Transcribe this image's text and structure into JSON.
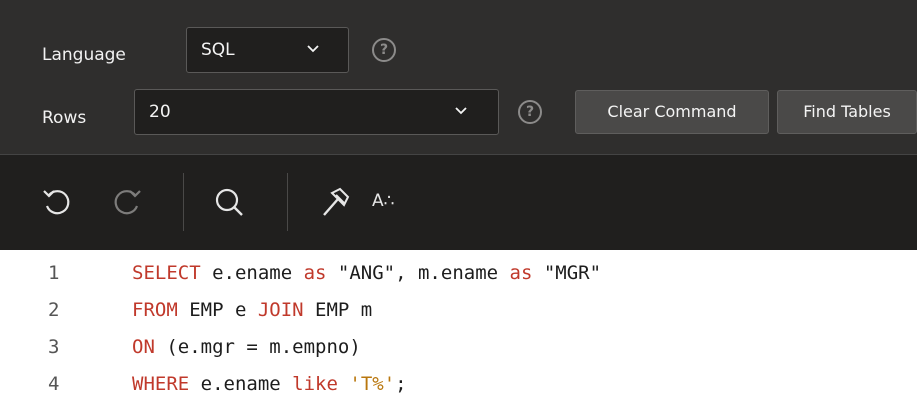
{
  "settings": {
    "language_label": "Language",
    "language_value": "SQL",
    "rows_label": "Rows",
    "rows_value": "20",
    "help_glyph": "?",
    "clear_command_label": "Clear Command",
    "find_tables_label": "Find Tables"
  },
  "toolbar": {
    "icons": [
      "undo-icon",
      "redo-icon",
      "search-icon",
      "hammer-icon",
      "text-format-icon"
    ],
    "format_label": "A∴"
  },
  "editor": {
    "lines": [
      {
        "number": "1",
        "tokens": [
          {
            "t": "SELECT",
            "k": "kw"
          },
          {
            "t": " e.ename ",
            "k": ""
          },
          {
            "t": "as",
            "k": "kw"
          },
          {
            "t": " \"ANG\", m.ename ",
            "k": ""
          },
          {
            "t": "as",
            "k": "kw"
          },
          {
            "t": " \"MGR\"",
            "k": ""
          }
        ]
      },
      {
        "number": "2",
        "tokens": [
          {
            "t": "FROM",
            "k": "kw"
          },
          {
            "t": " EMP e ",
            "k": ""
          },
          {
            "t": "JOIN",
            "k": "kw"
          },
          {
            "t": " EMP m",
            "k": ""
          }
        ]
      },
      {
        "number": "3",
        "tokens": [
          {
            "t": "ON",
            "k": "kw"
          },
          {
            "t": " (e.mgr = m.empno)",
            "k": ""
          }
        ]
      },
      {
        "number": "4",
        "tokens": [
          {
            "t": "WHERE",
            "k": "kw"
          },
          {
            "t": " e.ename ",
            "k": ""
          },
          {
            "t": "like",
            "k": "kw"
          },
          {
            "t": " ",
            "k": ""
          },
          {
            "t": "'T%'",
            "k": "str"
          },
          {
            "t": ";",
            "k": ""
          }
        ]
      }
    ]
  },
  "colors": {
    "settings_bg": "#2f2e2d",
    "toolbar_bg": "#201f1e",
    "keyword": "#c0392b",
    "string": "#b9770e"
  }
}
